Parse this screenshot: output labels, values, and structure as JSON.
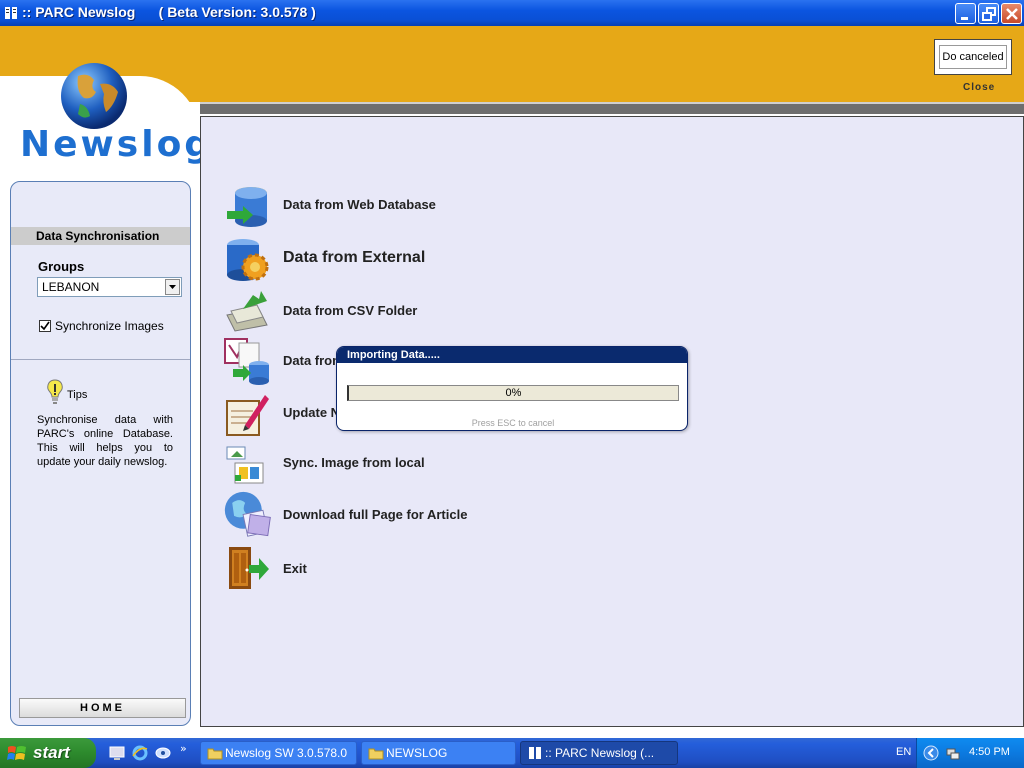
{
  "window": {
    "title": ":: PARC Newslog      ( Beta Version: 3.0.578 )"
  },
  "header": {
    "logo_text": "Newslog",
    "status_text": "Do canceled",
    "close_label": "Close"
  },
  "sidebar": {
    "section_title": "Data Synchronisation",
    "groups_label": "Groups",
    "groups_value": "LEBANON",
    "sync_images_label": "Synchronize Images",
    "sync_images_checked": true,
    "tips_label": "Tips",
    "tips_text": "Synchronise data with PARC's online Database. This will helps you to update your daily newslog.",
    "home_label": "HOME"
  },
  "menu": {
    "items": [
      {
        "label": "Data from Web Database",
        "icon": "database-sync-icon"
      },
      {
        "label": "Data from External",
        "icon": "database-gear-icon"
      },
      {
        "label": "Data from CSV Folder",
        "icon": "csv-folder-icon"
      },
      {
        "label": "Data from",
        "icon": "access-database-icon"
      },
      {
        "label": "Update N",
        "icon": "notepad-pen-icon"
      },
      {
        "label": "Sync. Image from local",
        "icon": "image-sync-icon"
      },
      {
        "label": "Download full Page for Article",
        "icon": "globe-page-icon"
      },
      {
        "label": "Exit",
        "icon": "exit-door-icon"
      }
    ]
  },
  "dialog": {
    "title": "Importing Data.....",
    "progress_text": "0%",
    "progress_value": 0,
    "hint": "Press ESC to cancel"
  },
  "taskbar": {
    "start_label": "start",
    "tasks": [
      {
        "label": "Newslog SW 3.0.578.0",
        "icon": "folder-icon"
      },
      {
        "label": "NEWSLOG",
        "icon": "folder-icon"
      },
      {
        "label": ":: PARC Newslog     (...",
        "icon": "app-icon",
        "active": true
      }
    ],
    "language": "EN",
    "clock": "4:50 PM"
  },
  "colors": {
    "banner": "#e6a817",
    "accent_blue": "#1e6fd0",
    "panel_bg": "#e8e8f8",
    "dialog_title_bg": "#0a2a6e"
  }
}
